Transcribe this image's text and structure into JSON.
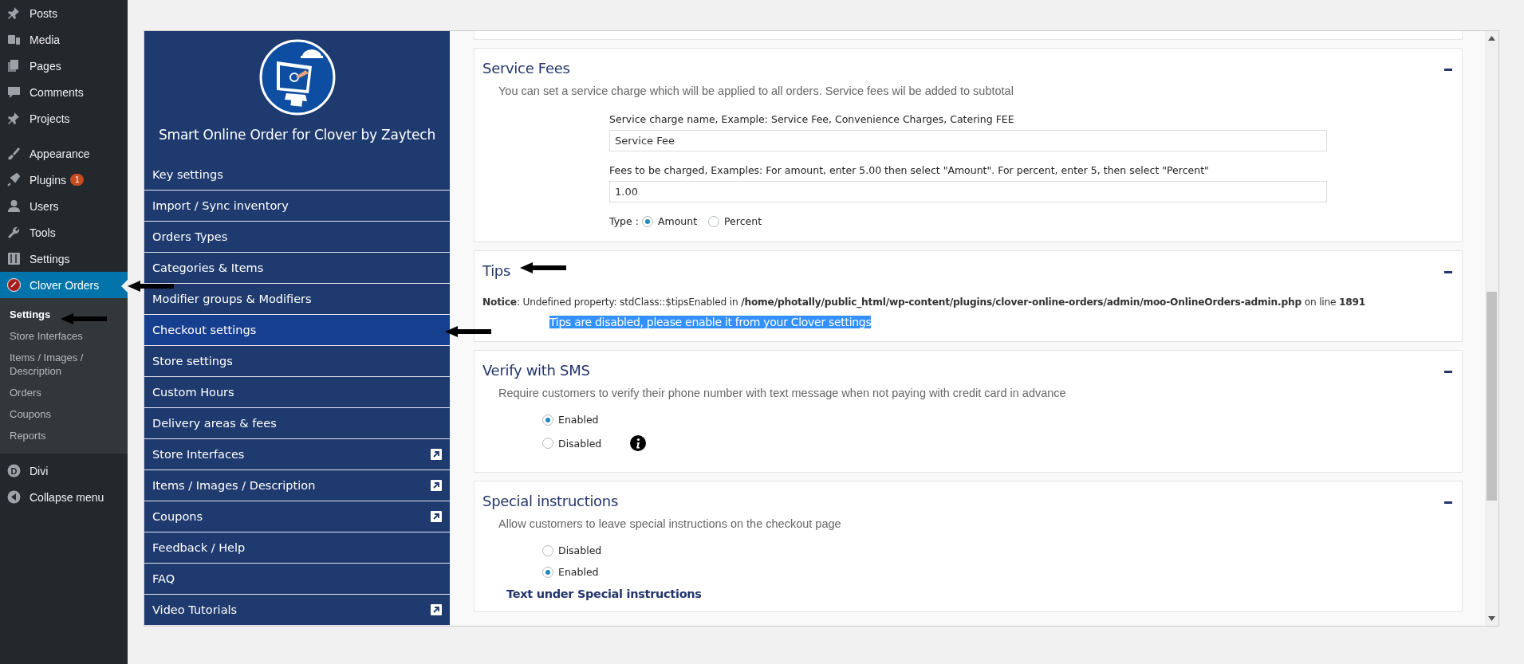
{
  "wp_menu": {
    "items": [
      {
        "label": "Posts",
        "selected": false
      },
      {
        "label": "Media",
        "selected": false
      },
      {
        "label": "Pages",
        "selected": false
      },
      {
        "label": "Comments",
        "selected": false
      },
      {
        "label": "Projects",
        "selected": false
      },
      {
        "label": "Appearance",
        "selected": false
      },
      {
        "label": "Plugins",
        "selected": false,
        "badge": "1"
      },
      {
        "label": "Users",
        "selected": false
      },
      {
        "label": "Tools",
        "selected": false
      },
      {
        "label": "Settings",
        "selected": false
      },
      {
        "label": "Clover Orders",
        "selected": true,
        "children": [
          {
            "label": "Settings",
            "selected": true
          },
          {
            "label": "Store Interfaces",
            "selected": false
          },
          {
            "label": "Items / Images / Description",
            "selected": false
          },
          {
            "label": "Orders",
            "selected": false
          },
          {
            "label": "Coupons",
            "selected": false
          },
          {
            "label": "Reports",
            "selected": false
          }
        ]
      },
      {
        "label": "Divi",
        "selected": false,
        "monogram": "D"
      },
      {
        "label": "Collapse menu",
        "selected": false
      }
    ]
  },
  "plugin": {
    "title": "Smart Online Order for Clover by Zaytech",
    "nav": [
      {
        "label": "Key settings",
        "selected": false,
        "external": false
      },
      {
        "label": "Import / Sync inventory",
        "selected": false,
        "external": false
      },
      {
        "label": "Orders Types",
        "selected": false,
        "external": false
      },
      {
        "label": "Categories & Items",
        "selected": false,
        "external": false
      },
      {
        "label": "Modifier groups & Modifiers",
        "selected": false,
        "external": false
      },
      {
        "label": "Checkout settings",
        "selected": true,
        "external": false
      },
      {
        "label": "Store settings",
        "selected": false,
        "external": false
      },
      {
        "label": "Custom Hours",
        "selected": false,
        "external": false
      },
      {
        "label": "Delivery areas & fees",
        "selected": false,
        "external": false
      },
      {
        "label": "Store Interfaces",
        "selected": false,
        "external": true
      },
      {
        "label": "Items / Images / Description",
        "selected": false,
        "external": true
      },
      {
        "label": "Coupons",
        "selected": false,
        "external": true
      },
      {
        "label": "Feedback / Help",
        "selected": false,
        "external": false
      },
      {
        "label": "FAQ",
        "selected": false,
        "external": false
      },
      {
        "label": "Video Tutorials",
        "selected": false,
        "external": true
      }
    ]
  },
  "panels": [
    {
      "kind": "fields",
      "title": "Service Fees",
      "description": "You can set a service charge which will be applied to all orders. Service fees wil be added to subtotal",
      "fields": [
        {
          "label": "Service charge name, Example: Service Fee, Convenience Charges, Catering FEE",
          "value": "Service Fee"
        },
        {
          "label": "Fees to be charged, Examples: For amount, enter 5.00 then select \"Amount\". For percent, enter 5, then select \"Percent\"",
          "value": "1.00"
        }
      ],
      "type_label": "Type :",
      "options": [
        {
          "label": "Amount",
          "selected": true
        },
        {
          "label": "Percent",
          "selected": false
        }
      ]
    },
    {
      "kind": "notice",
      "title": "Tips",
      "notice": "**Notice**: Undefined property: stdClass::$tipsEnabled in **/home/photally/public_html/wp-content/plugins/clover-online-orders/admin/moo-OnlineOrders-admin.php** on line **1891**",
      "message": "Tips are disabled, please enable it from your Clover settings"
    },
    {
      "kind": "radios",
      "title": "Verify with SMS",
      "description": "Require customers to verify their phone number with text message when not paying with credit card in advance",
      "info": true,
      "options": [
        {
          "label": "Enabled",
          "selected": true
        },
        {
          "label": "Disabled",
          "selected": false
        }
      ]
    },
    {
      "kind": "radios",
      "title": "Special instructions",
      "description": "Allow customers to leave special instructions on the checkout page",
      "info": false,
      "options": [
        {
          "label": "Disabled",
          "selected": false
        },
        {
          "label": "Enabled",
          "selected": true
        }
      ],
      "subheading": "Text under Special instructions"
    }
  ]
}
